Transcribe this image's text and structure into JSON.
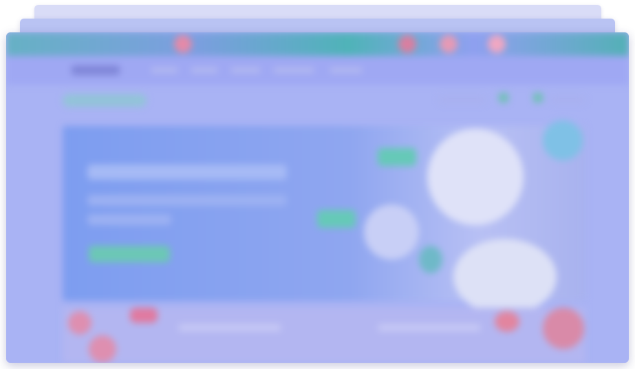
{
  "window": {
    "title": "",
    "state": "fully blurred; no legible text"
  },
  "colors": {
    "banner_start": "#66b1c4",
    "banner_accent": "#e48aa8",
    "window_tint": "#a9b3f4",
    "hero_start": "#7d9df0",
    "hero_cta": "#6cc7b6"
  },
  "icons": {
    "toolbar_first": "square-icon",
    "toolbar_second": "square-icon",
    "hero_avatar": "circle-badge-icon"
  }
}
